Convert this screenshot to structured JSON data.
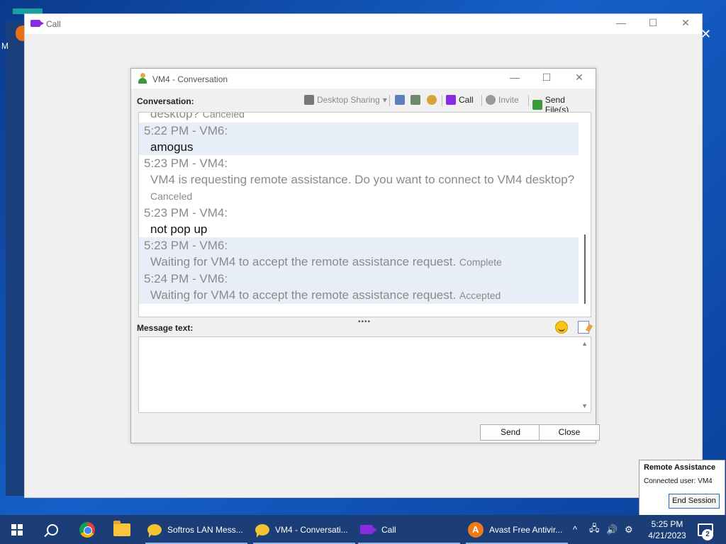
{
  "call_window": {
    "title": "Call",
    "controls": {
      "minimize": "—",
      "maximize": "☐",
      "close": "✕"
    }
  },
  "conversation": {
    "title": "VM4 - Conversation",
    "controls": {
      "minimize": "—",
      "maximize": "☐",
      "close": "✕"
    },
    "label": "Conversation:",
    "toolbar": {
      "desktop_sharing": "Desktop Sharing",
      "call": "Call",
      "invite": "Invite",
      "send_files": "Send File(s)"
    },
    "messages": [
      {
        "head": "",
        "body": "desktop?",
        "status": "Canceled",
        "tone": "gray",
        "shaded": false,
        "partial": true
      },
      {
        "head": "5:22 PM - VM6:",
        "body": "amogus",
        "status": "",
        "tone": "dark",
        "shaded": true
      },
      {
        "head": "5:23 PM - VM4:",
        "body": "VM4 is requesting remote assistance. Do you want to connect to VM4 desktop?",
        "status": "Canceled",
        "tone": "gray",
        "shaded": false
      },
      {
        "head": "5:23 PM - VM4:",
        "body": "not pop up",
        "status": "",
        "tone": "dark",
        "shaded": false
      },
      {
        "head": "5:23 PM - VM6:",
        "body": "Waiting for VM4 to accept the remote assistance request.",
        "status": "Complete",
        "tone": "gray",
        "shaded": true
      },
      {
        "head": "5:24 PM - VM6:",
        "body": "Waiting for VM4 to accept the remote assistance request.",
        "status": "Accepted",
        "tone": "gray",
        "shaded": true
      }
    ],
    "message_text_label": "Message text:",
    "message_value": "",
    "send_label": "Send",
    "close_label": "Close"
  },
  "remote_assistance": {
    "title": "Remote Assistance",
    "connected_label": "Connected user:",
    "connected_user": "VM4",
    "end_session": "End Session"
  },
  "taskbar": {
    "apps": [
      {
        "label": "Softros LAN Mess..."
      },
      {
        "label": "VM4 - Conversati..."
      },
      {
        "label": "Call"
      },
      {
        "label": "Avast Free Antivir..."
      }
    ],
    "time": "5:25 PM",
    "date": "4/21/2023",
    "notification_count": "2",
    "tray": {
      "chevron": "^",
      "network": "🖧",
      "volume": "🔊"
    }
  }
}
